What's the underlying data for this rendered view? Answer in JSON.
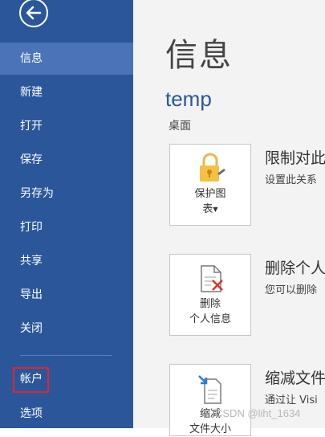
{
  "nav": {
    "items": [
      {
        "label": "信息"
      },
      {
        "label": "新建"
      },
      {
        "label": "打开"
      },
      {
        "label": "保存"
      },
      {
        "label": "另存为"
      },
      {
        "label": "打印"
      },
      {
        "label": "共享"
      },
      {
        "label": "导出"
      },
      {
        "label": "关闭"
      },
      {
        "label": "帐户"
      },
      {
        "label": "选项"
      }
    ],
    "colors": {
      "background": "#2b579a",
      "active": "#4a73b8",
      "highlight_border": "#e0262e"
    }
  },
  "main": {
    "title": "信息",
    "doc_name": "temp",
    "doc_location": "桌面",
    "sections": [
      {
        "tile_label_1": "保护图",
        "tile_label_2": "表",
        "title": "限制对此",
        "desc": "设置此关系"
      },
      {
        "tile_label_1": "删除",
        "tile_label_2": "个人信息",
        "title": "删除个人",
        "desc": "您可以删除"
      },
      {
        "tile_label_1": "缩减",
        "tile_label_2": "文件大小",
        "title": "缩减文件",
        "desc": "通过让 Visi"
      }
    ]
  },
  "watermark": "CSDN @liht_1634"
}
